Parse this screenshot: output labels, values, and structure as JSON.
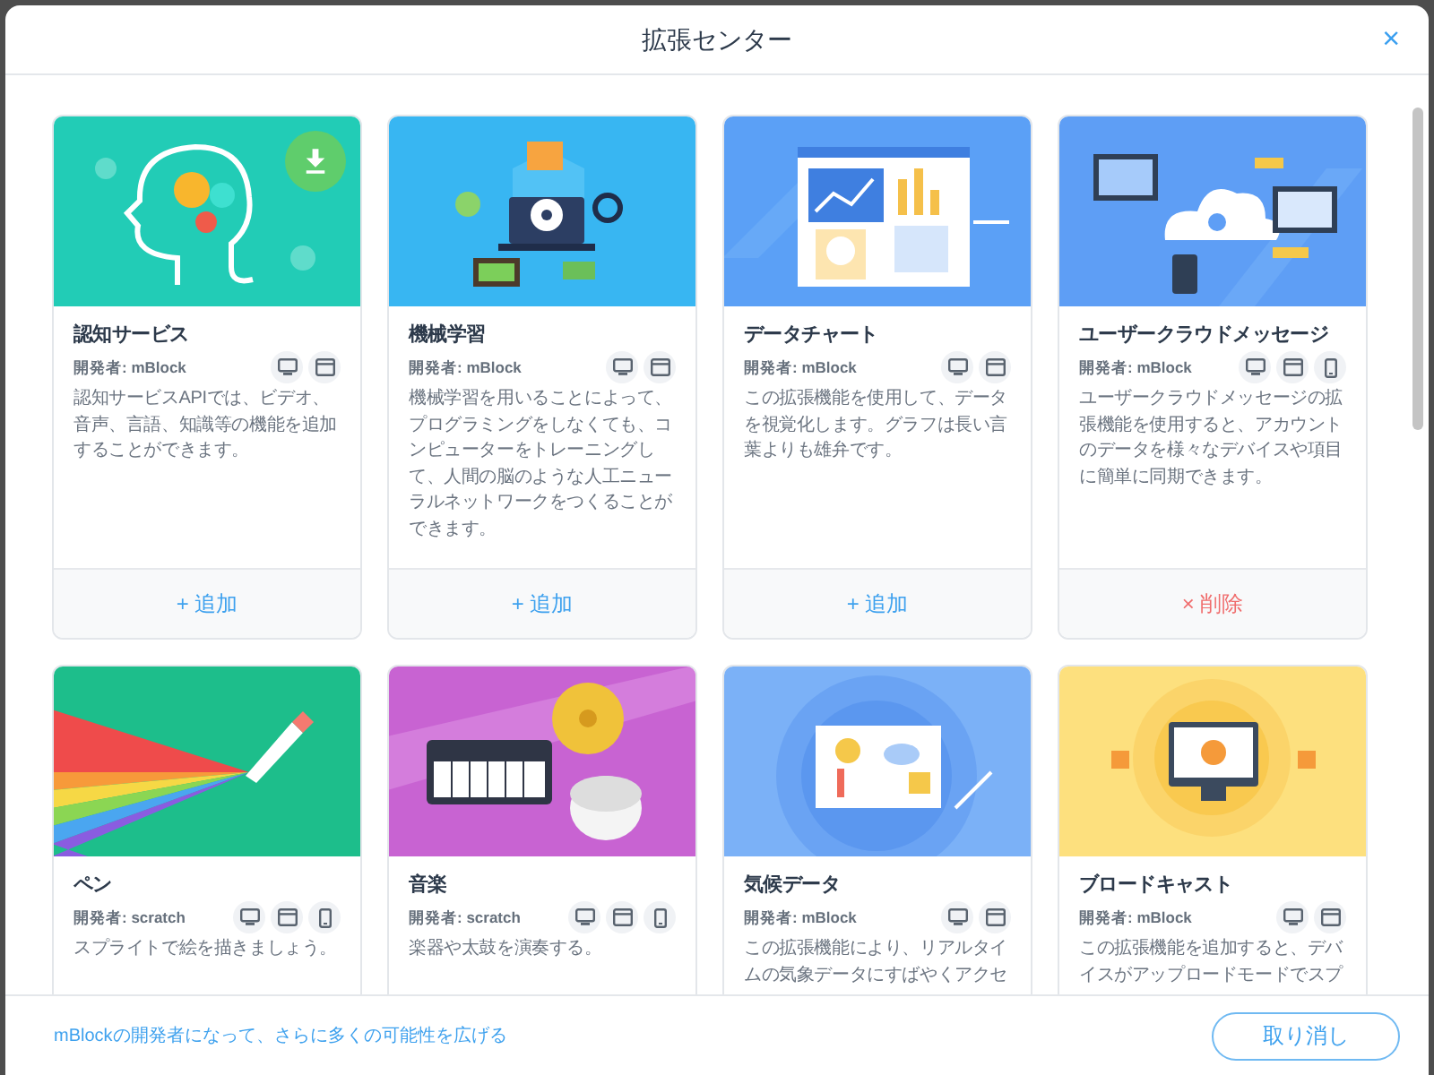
{
  "dialog": {
    "title": "拡張センター",
    "close": "×"
  },
  "extensions": [
    {
      "title": "認知サービス",
      "developer": "開発者: mBlock",
      "platforms": [
        {
          "kind": "desktop"
        },
        {
          "kind": "browser"
        }
      ],
      "downloadable": true,
      "description": [
        "認知サービスAPIでは、ビデオ、",
        "音声、言語、知識等の機能を追加",
        "することができます。"
      ],
      "action": {
        "kind": "add",
        "icon": "+",
        "label": "追加"
      }
    },
    {
      "title": "機械学習",
      "developer": "開発者: mBlock",
      "platforms": [
        {
          "kind": "desktop"
        },
        {
          "kind": "browser"
        }
      ],
      "downloadable": false,
      "description": [
        "機械学習を用いることによって、",
        "プログラミングをしなくても、コ",
        "ンピューターをトレーニングし",
        "て、人間の脳のような人工ニュー",
        "ラルネットワークをつくることが",
        "できます。"
      ],
      "action": {
        "kind": "add",
        "icon": "+",
        "label": "追加"
      }
    },
    {
      "title": "データチャート",
      "developer": "開発者: mBlock",
      "platforms": [
        {
          "kind": "desktop"
        },
        {
          "kind": "browser"
        }
      ],
      "downloadable": false,
      "description": [
        "この拡張機能を使用して、データ",
        "を視覚化します。グラフは長い言",
        "葉よりも雄弁です。"
      ],
      "action": {
        "kind": "add",
        "icon": "+",
        "label": "追加"
      }
    },
    {
      "title": "ユーザークラウドメッセージ",
      "developer": "開発者: mBlock",
      "platforms": [
        {
          "kind": "desktop"
        },
        {
          "kind": "browser"
        },
        {
          "kind": "mobile"
        }
      ],
      "downloadable": false,
      "description": [
        "ユーザークラウドメッセージの拡",
        "張機能を使用すると、アカウント",
        "のデータを様々なデバイスや項目",
        "に簡単に同期できます。"
      ],
      "action": {
        "kind": "remove",
        "icon": "×",
        "label": "削除"
      }
    },
    {
      "title": "ペン",
      "developer": "開発者: scratch",
      "platforms": [
        {
          "kind": "desktop"
        },
        {
          "kind": "browser"
        },
        {
          "kind": "mobile"
        }
      ],
      "downloadable": false,
      "description": [
        "スプライトで絵を描きましょう。"
      ]
    },
    {
      "title": "音楽",
      "developer": "開発者: scratch",
      "platforms": [
        {
          "kind": "desktop"
        },
        {
          "kind": "browser"
        },
        {
          "kind": "mobile"
        }
      ],
      "downloadable": false,
      "description": [
        "楽器や太鼓を演奏する。"
      ]
    },
    {
      "title": "気候データ",
      "developer": "開発者: mBlock",
      "platforms": [
        {
          "kind": "desktop"
        },
        {
          "kind": "browser"
        }
      ],
      "downloadable": false,
      "description": [
        "この拡張機能により、リアルタイ",
        "ムの気象データにすばやくアクセ"
      ]
    },
    {
      "title": "ブロードキャスト",
      "developer": "開発者: mBlock",
      "platforms": [
        {
          "kind": "desktop"
        },
        {
          "kind": "browser"
        }
      ],
      "downloadable": false,
      "description": [
        "この拡張機能を追加すると、デバ",
        "イスがアップロードモードでスプ"
      ]
    }
  ],
  "footer": {
    "link": "mBlockの開発者になって、さらに多くの可能性を広げる",
    "cancel": "取り消し"
  }
}
